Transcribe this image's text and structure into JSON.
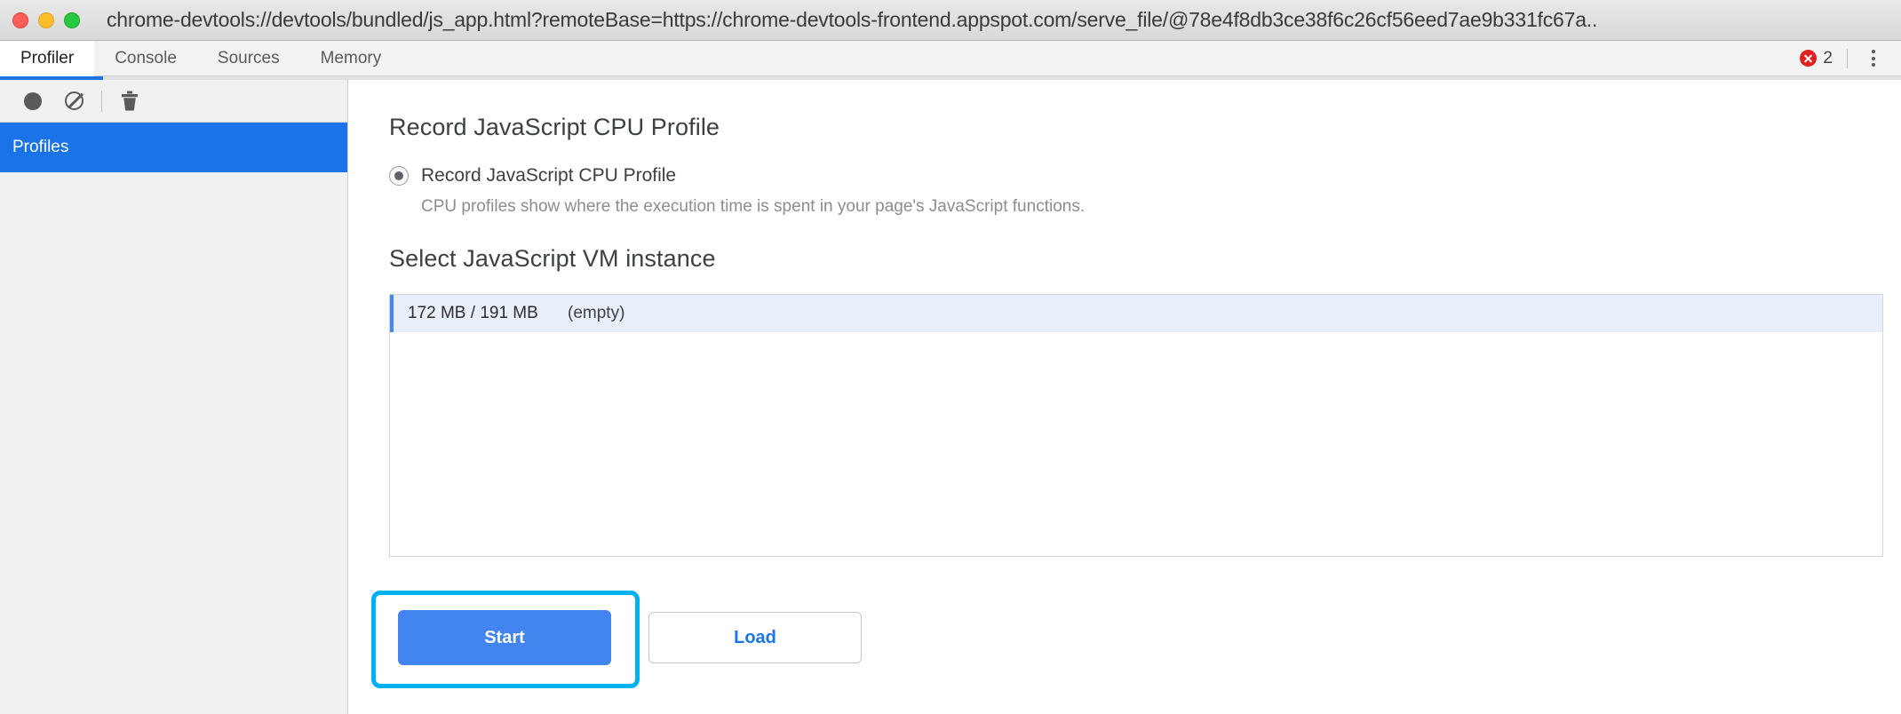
{
  "window": {
    "title": "chrome-devtools://devtools/bundled/js_app.html?remoteBase=https://chrome-devtools-frontend.appspot.com/serve_file/@78e4f8db3ce38f6c26cf56eed7ae9b331fc67a..",
    "controls": {
      "close": "close-button",
      "minimize": "minimize-button",
      "maximize": "maximize-button"
    }
  },
  "tabstrip": {
    "tabs": [
      {
        "label": "Profiler",
        "active": true
      },
      {
        "label": "Console",
        "active": false
      },
      {
        "label": "Sources",
        "active": false
      },
      {
        "label": "Memory",
        "active": false
      }
    ],
    "error_count": "2",
    "error_icon": "error-circle-icon",
    "menu_icon": "more-vertical-icon"
  },
  "progress": {
    "percent": 5.4,
    "color": "#1a73e8"
  },
  "sidebar": {
    "toolbar": [
      {
        "icon": "record-icon",
        "name": "record-button"
      },
      {
        "icon": "no-entry-icon",
        "name": "clear-button"
      },
      {
        "icon": "trash-icon",
        "name": "delete-button"
      }
    ],
    "items": [
      {
        "label": "Profiles",
        "selected": true
      }
    ],
    "selected_color": "#1a73e8"
  },
  "main": {
    "heading_record": "Record JavaScript CPU Profile",
    "radio": {
      "label": "Record JavaScript CPU Profile",
      "checked": true,
      "description": "CPU profiles show where the execution time is spent in your page's JavaScript functions."
    },
    "heading_select_vm": "Select JavaScript VM instance",
    "vm_list": {
      "columns": [
        "memory",
        "state"
      ],
      "rows": [
        {
          "memory": "172 MB / 191 MB",
          "state": "(empty)",
          "selected": true
        }
      ]
    },
    "buttons": {
      "start": "Start",
      "load": "Load"
    },
    "highlight_color": "#00b0f0",
    "start_button_color": "#4285ee",
    "load_button_text_color": "#1a73e8"
  }
}
